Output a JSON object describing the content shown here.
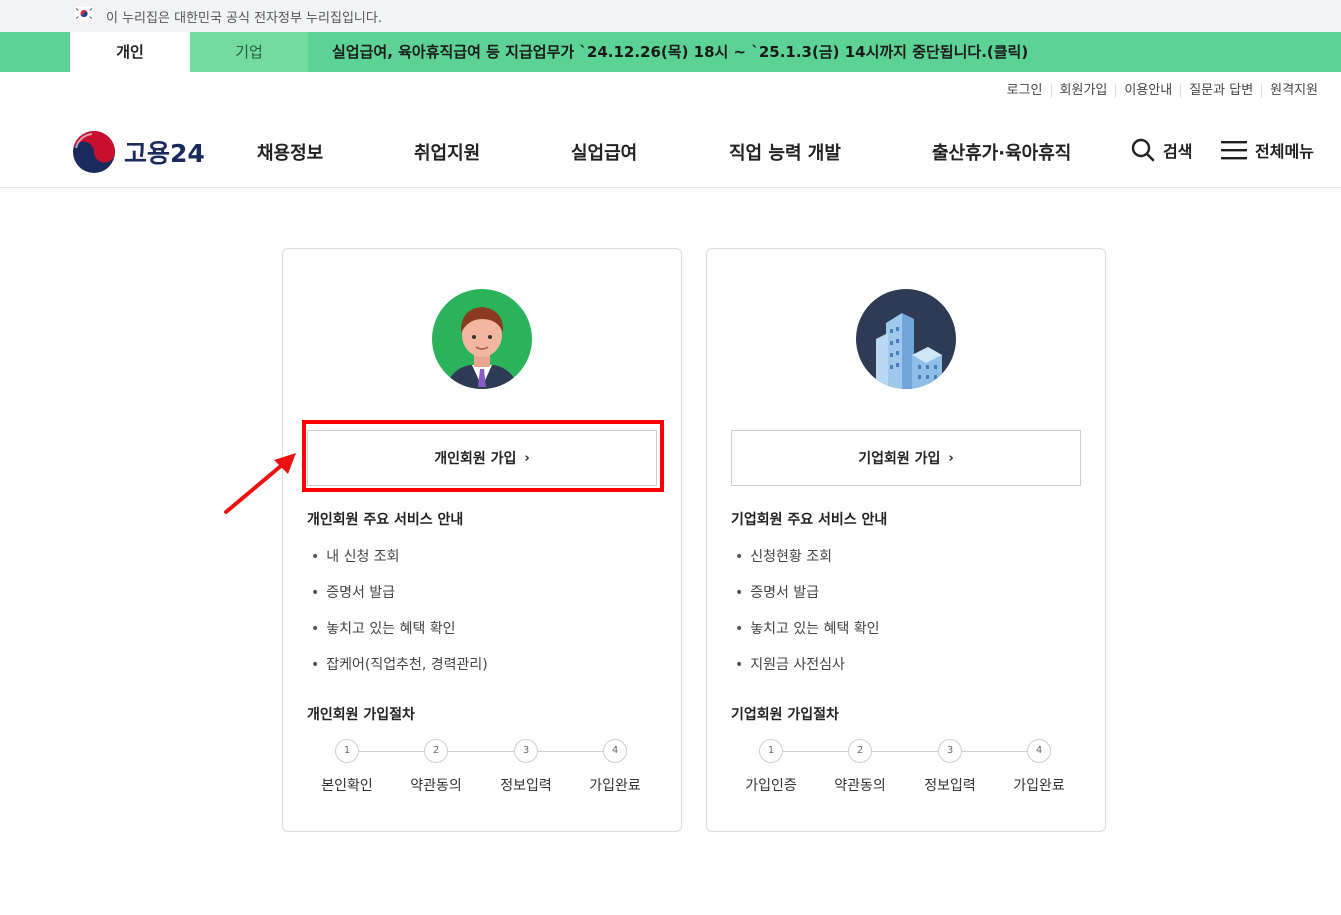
{
  "gov_banner": {
    "text": "이 누리집은 대한민국 공식 전자정부 누리집입니다."
  },
  "notice": {
    "tabs": [
      {
        "label": "개인"
      },
      {
        "label": "기업"
      }
    ],
    "text": "실업급여, 육아휴직급여 등 지급업무가 `24.12.26(목) 18시 ~ `25.1.3(금) 14시까지 중단됩니다.(클릭)"
  },
  "util_links": [
    "로그인",
    "회원가입",
    "이용안내",
    "질문과 답변",
    "원격지원"
  ],
  "header": {
    "logo_text": "고용24",
    "nav": [
      "채용정보",
      "취업지원",
      "실업급여",
      "직업 능력 개발",
      "출산휴가·육아휴직"
    ],
    "search_label": "검색",
    "menu_label": "전체메뉴"
  },
  "cards": [
    {
      "join_label": "개인회원 가입",
      "services_title": "개인회원 주요 서비스 안내",
      "services": [
        "내 신청 조회",
        "증명서 발급",
        "놓치고 있는 혜택 확인",
        "잡케어(직업추천, 경력관리)"
      ],
      "process_title": "개인회원 가입절차",
      "steps": [
        {
          "num": "1",
          "label": "본인확인"
        },
        {
          "num": "2",
          "label": "약관동의"
        },
        {
          "num": "3",
          "label": "정보입력"
        },
        {
          "num": "4",
          "label": "가입완료"
        }
      ]
    },
    {
      "join_label": "기업회원 가입",
      "services_title": "기업회원 주요 서비스 안내",
      "services": [
        "신청현황 조회",
        "증명서 발급",
        "놓치고 있는 혜택 확인",
        "지원금 사전심사"
      ],
      "process_title": "기업회원 가입절차",
      "steps": [
        {
          "num": "1",
          "label": "가입인증"
        },
        {
          "num": "2",
          "label": "약관동의"
        },
        {
          "num": "3",
          "label": "정보입력"
        },
        {
          "num": "4",
          "label": "가입완료"
        }
      ]
    }
  ],
  "colors": {
    "notice_green": "#5cd394",
    "highlight_red": "#ff0000",
    "logo_navy": "#1b2a5c"
  }
}
